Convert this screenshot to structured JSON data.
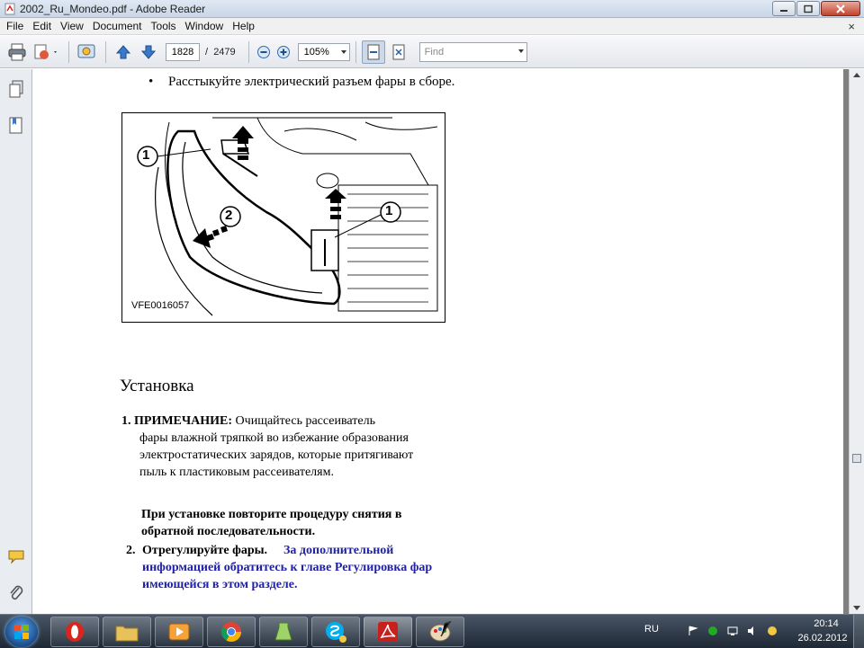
{
  "window": {
    "title": "2002_Ru_Mondeo.pdf - Adobe Reader"
  },
  "menu": {
    "items": [
      "File",
      "Edit",
      "View",
      "Document",
      "Tools",
      "Window",
      "Help"
    ],
    "close_glyph": "×"
  },
  "toolbar": {
    "current_page": "1828",
    "page_separator": "/",
    "total_pages": "2479",
    "zoom": "105%",
    "find_placeholder": "Find"
  },
  "document": {
    "bullet": "Расстыкуйте электрический разъем фары  в сборе.",
    "figure": {
      "code": "VFE0016057",
      "callouts": [
        "1",
        "2",
        "1"
      ]
    },
    "heading": "Установка",
    "step1": {
      "number": "1.",
      "note_label": "ПРИМЕЧАНИЕ:",
      "note_first": " Очищайтесь рассеиватель",
      "note_rest": "фары влажной  тряпкой во избежание образования  электростатических зарядов, которые  притягивают пыль к пластиковым рассеивателям."
    },
    "install_note": "При установке повторите процедуру  снятия в обратной последовательности.",
    "step2": {
      "number": "2.",
      "text": "Отрегулируйте фары.",
      "link_first": "За дополнительной",
      "link_rest": "информацией обратитесь к главе Регулировка фар имеющейся в этом разделе."
    }
  },
  "taskbar": {
    "apps": [
      "opera-icon",
      "explorer-icon",
      "media-player-icon",
      "chrome-icon",
      "utility-icon",
      "skype-icon",
      "adobe-reader-icon",
      "paint-icon"
    ],
    "language": "RU",
    "time": "20:14",
    "date": "26.02.2012"
  },
  "colors": {
    "link": "#1f1fa8",
    "taskbar": "#2a3544"
  }
}
